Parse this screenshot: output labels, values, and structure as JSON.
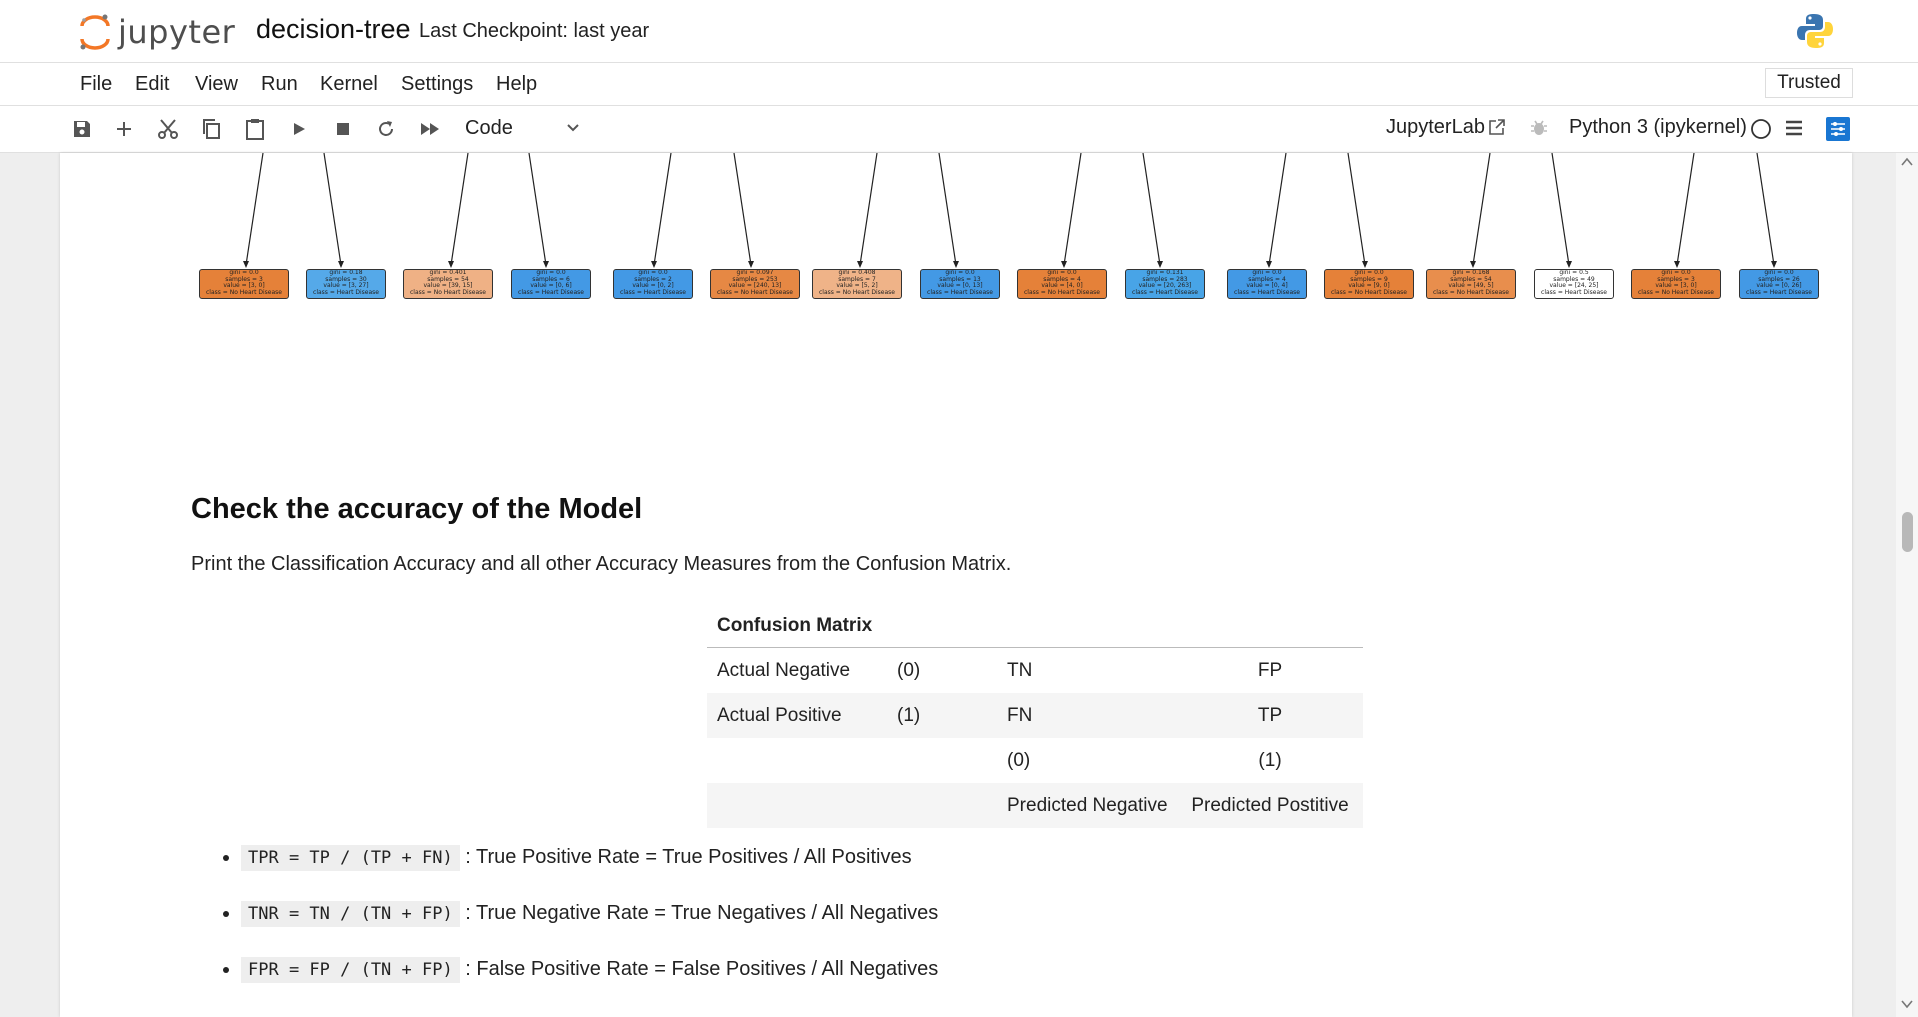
{
  "header": {
    "logo_text": "jupyter",
    "notebook_name": "decision-tree",
    "checkpoint": "Last Checkpoint: last year"
  },
  "menu": [
    "File",
    "Edit",
    "View",
    "Run",
    "Kernel",
    "Settings",
    "Help"
  ],
  "trusted": "Trusted",
  "toolbar": {
    "cell_type": "Code",
    "jupyterlab_link": "JupyterLab",
    "kernel_name": "Python 3 (ipykernel)"
  },
  "tree_nodes": [
    {
      "lines": [
        "gini = 0.0",
        "samples = 3",
        "value = [3, 0]",
        "class = No Heart Disease"
      ],
      "color": "#e58139"
    },
    {
      "lines": [
        "gini = 0.18",
        "samples = 30",
        "value = [3, 27]",
        "class = Heart Disease"
      ],
      "color": "#55a9e9"
    },
    {
      "lines": [
        "gini = 0.401",
        "samples = 54",
        "value = [39, 15]",
        "class = No Heart Disease"
      ],
      "color": "#efb185"
    },
    {
      "lines": [
        "gini = 0.0",
        "samples = 6",
        "value = [0, 6]",
        "class = Heart Disease"
      ],
      "color": "#4399e5"
    },
    {
      "lines": [
        "gini = 0.0",
        "samples = 2",
        "value = [0, 2]",
        "class = Heart Disease"
      ],
      "color": "#4399e5"
    },
    {
      "lines": [
        "gini = 0.097",
        "samples = 253",
        "value = [240, 13]",
        "class = No Heart Disease"
      ],
      "color": "#e68844"
    },
    {
      "lines": [
        "gini = 0.408",
        "samples = 7",
        "value = [5, 2]",
        "class = No Heart Disease"
      ],
      "color": "#efb388"
    },
    {
      "lines": [
        "gini = 0.0",
        "samples = 13",
        "value = [0, 13]",
        "class = Heart Disease"
      ],
      "color": "#4399e5"
    },
    {
      "lines": [
        "gini = 0.0",
        "samples = 4",
        "value = [4, 0]",
        "class = No Heart Disease"
      ],
      "color": "#e58139"
    },
    {
      "lines": [
        "gini = 0.131",
        "samples = 283",
        "value = [20, 263]",
        "class = Heart Disease"
      ],
      "color": "#48a4e7"
    },
    {
      "lines": [
        "gini = 0.0",
        "samples = 4",
        "value = [0, 4]",
        "class = Heart Disease"
      ],
      "color": "#4399e5"
    },
    {
      "lines": [
        "gini = 0.0",
        "samples = 9",
        "value = [9, 0]",
        "class = No Heart Disease"
      ],
      "color": "#e58139"
    },
    {
      "lines": [
        "gini = 0.168",
        "samples = 54",
        "value = [49, 5]",
        "class = No Heart Disease"
      ],
      "color": "#e88e4d"
    },
    {
      "lines": [
        "gini = 0.5",
        "samples = 49",
        "value = [24, 25]",
        "class = Heart Disease"
      ],
      "color": "#ffffff"
    },
    {
      "lines": [
        "gini = 0.0",
        "samples = 3",
        "value = [3, 0]",
        "class = No Heart Disease"
      ],
      "color": "#e58139"
    },
    {
      "lines": [
        "gini = 0.0",
        "samples = 26",
        "value = [0, 26]",
        "class = Heart Disease"
      ],
      "color": "#4399e5"
    }
  ],
  "section": {
    "heading": "Check the accuracy of the Model",
    "description": "Print the Classification Accuracy and all other Accuracy Measures from the Confusion Matrix."
  },
  "confusion_table": {
    "header": "Confusion Matrix",
    "rows": [
      [
        "Actual Negative",
        "(0)",
        "TN",
        "FP"
      ],
      [
        "Actual Positive",
        "(1)",
        "FN",
        "TP"
      ],
      [
        "",
        "",
        "(0)",
        "(1)"
      ],
      [
        "",
        "",
        "Predicted Negative",
        "Predicted Postitive"
      ]
    ]
  },
  "measures": [
    {
      "code": "TPR = TP / (TP + FN)",
      "text": ": True Positive Rate = True Positives / All Positives"
    },
    {
      "code": "TNR = TN / (TN + FP)",
      "text": ": True Negative Rate = True Negatives / All Negatives"
    },
    {
      "code": "FPR = FP / (TN + FP)",
      "text": ": False Positive Rate = False Positives / All Negatives"
    }
  ]
}
